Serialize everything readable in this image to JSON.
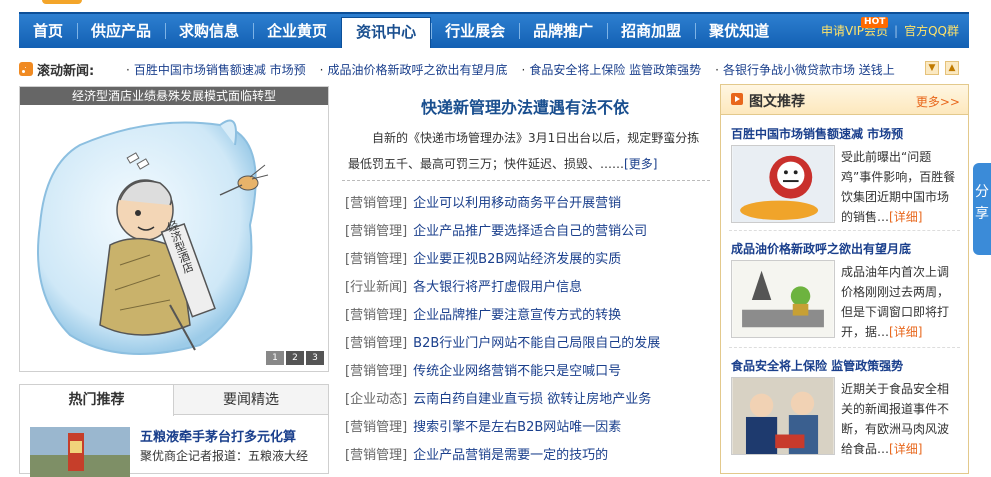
{
  "nav": {
    "items": [
      "首页",
      "供应产品",
      "求购信息",
      "企业黄页",
      "资讯中心",
      "行业展会",
      "品牌推广",
      "招商加盟",
      "聚优知道"
    ],
    "active_index": 4,
    "vip_label": "申请VIP会员",
    "hot_badge": "HOT",
    "qq_label": "官方QQ群"
  },
  "scroll_news": {
    "label": "滚动新闻:",
    "items": [
      "百胜中国市场销售额速减 市场预",
      "成品油价格新政呼之欲出有望月底",
      "食品安全将上保险 监管政策强势",
      "各银行争战小微贷款市场 送钱上"
    ]
  },
  "slideshow": {
    "caption": "经济型酒店业绩悬殊发展模式面临转型",
    "pages": [
      "1",
      "2",
      "3"
    ],
    "sign_text": "经济型酒店"
  },
  "left_tabs": {
    "tabs": [
      "热门推荐",
      "要闻精选"
    ],
    "headline": "五粮液牵手茅台打多元化算",
    "text": "聚优商企记者报道：五粮液大经"
  },
  "center": {
    "headline": "快递新管理办法遭遇有法不依",
    "summary": "自新的《快递市场管理办法》3月1日出台以后，规定野蛮分拣最低罚五千、最高可罚三万；快件延迟、损毁、……",
    "more": "[更多]",
    "news": [
      {
        "cat": "[营销管理]",
        "title": "企业可以利用移动商务平台开展营销"
      },
      {
        "cat": "[营销管理]",
        "title": "企业产品推广要选择适合自己的营销公司"
      },
      {
        "cat": "[营销管理]",
        "title": "企业要正视B2B网站经济发展的实质"
      },
      {
        "cat": "[行业新闻]",
        "title": "各大银行将严打虚假用户信息"
      },
      {
        "cat": "[营销管理]",
        "title": "企业品牌推广要注意宣传方式的转换"
      },
      {
        "cat": "[营销管理]",
        "title": "B2B行业门户网站不能自己局限自己的发展"
      },
      {
        "cat": "[营销管理]",
        "title": "传统企业网络营销不能只是空喊口号"
      },
      {
        "cat": "[企业动态]",
        "title": "云南白药自建业直亏损 欲转让房地产业务"
      },
      {
        "cat": "[营销管理]",
        "title": "搜索引擎不是左右B2B网站唯一因素"
      },
      {
        "cat": "[营销管理]",
        "title": "企业产品营销是需要一定的技巧的"
      }
    ]
  },
  "recommend": {
    "title": "图文推荐",
    "more": "更多>>",
    "items": [
      {
        "head": "百胜中国市场销售额速减 市场预",
        "text": "受此前曝出“问题鸡”事件影响，百胜餐饮集团近期中国市场的销售…",
        "detail": "[详细]"
      },
      {
        "head": "成品油价格新政呼之欲出有望月底",
        "text": "成品油年内首次上调价格刚刚过去两周，但是下调窗口即将打开，据…",
        "detail": "[详细]"
      },
      {
        "head": "食品安全将上保险 监管政策强势",
        "text": "近期关于食品安全相关的新闻报道事件不断，有欧洲马肉风波给食品…",
        "detail": "[详细]"
      }
    ]
  },
  "share": {
    "label": "分享"
  },
  "colors": {
    "nav_blue": "#1a6cc2",
    "link_blue": "#1a3f8c",
    "accent_orange": "#e8671c"
  }
}
